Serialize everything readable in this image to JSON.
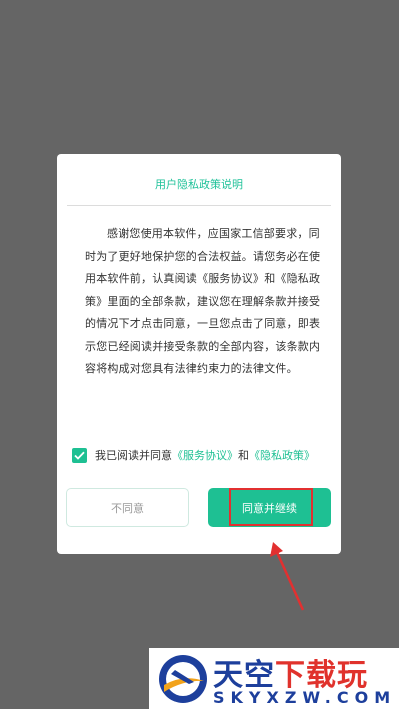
{
  "dialog": {
    "title": "用户隐私政策说明",
    "body": "感谢您使用本软件，应国家工信部要求，同时为了更好地保护您的合法权益。请您务必在使用本软件前，认真阅读《服务协议》和《隐私政策》里面的全部条款，建议您在理解条款并接受的情况下才点击同意，一旦您点击了同意，即表示您已经阅读并接受条款的全部内容，该条款内容将构成对您具有法律约束力的法律文件。",
    "agree_checkbox": {
      "checked": true,
      "prefix": "我已阅读并同意",
      "service_link": "《服务协议》",
      "and": "和",
      "privacy_link": "《隐私政策》"
    },
    "disagree_label": "不同意",
    "agree_label": "同意并继续"
  },
  "annotation": {
    "highlight_color": "#e23030"
  },
  "watermark": {
    "name_blue": "天空",
    "name_red": "下载玩",
    "domain": "SKYXZW.COM"
  },
  "colors": {
    "accent": "#1ec093",
    "overlay": "#656565"
  }
}
